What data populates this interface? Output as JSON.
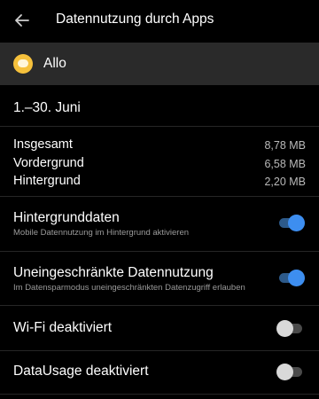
{
  "header": {
    "title": "Datennutzung durch Apps",
    "back_icon": "arrow-back-icon"
  },
  "app": {
    "name": "Allo",
    "icon": "allo-icon",
    "icon_color": "#f6c13c"
  },
  "period": "1.–30. Juni",
  "stats": [
    {
      "label": "Insgesamt",
      "value": "8,78 MB"
    },
    {
      "label": "Vordergrund",
      "value": "6,58 MB"
    },
    {
      "label": "Hintergrund",
      "value": "2,20 MB"
    }
  ],
  "settings": [
    {
      "title": "Hintergrunddaten",
      "subtitle": "Mobile Datennutzung im Hintergrund aktivieren",
      "enabled": true
    },
    {
      "title": "Uneingeschränkte Datennutzung",
      "subtitle": "Im Datensparmodus uneingeschränkten Datenzugriff erlauben",
      "enabled": true
    },
    {
      "title": "Wi-Fi deaktiviert",
      "subtitle": "",
      "enabled": false
    },
    {
      "title": "DataUsage deaktiviert",
      "subtitle": "",
      "enabled": false
    }
  ],
  "colors": {
    "accent": "#3d8ef0",
    "background": "#000000",
    "app_row": "#2a2a2a"
  }
}
